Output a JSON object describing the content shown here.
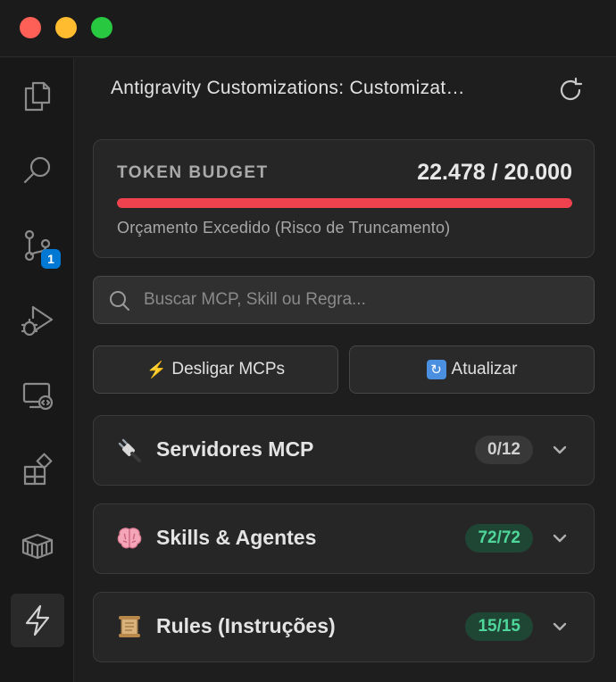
{
  "panel": {
    "title": "Antigravity Customizations: Customizat…",
    "refresh_icon": "refresh-icon"
  },
  "activity_bar": {
    "icons": [
      "files-icon",
      "search-icon",
      "source-control-icon",
      "run-debug-icon",
      "remote-explorer-icon",
      "extensions-icon",
      "package-icon",
      "lightning-icon"
    ],
    "source_control_badge": "1",
    "active": "lightning-icon"
  },
  "budget": {
    "label": "TOKEN BUDGET",
    "value": "22.478 / 20.000",
    "used": 22478,
    "limit": 20000,
    "fill_fraction": 1.0,
    "status": "Orçamento Excedido (Risco de Truncamento)",
    "bar_color": "#f0414f"
  },
  "search": {
    "placeholder": "Buscar MCP, Skill ou Regra..."
  },
  "actions": {
    "disable_mcps": "Desligar MCPs",
    "disable_mcps_emoji": "⚡",
    "refresh": "Atualizar",
    "refresh_emoji": "🔄"
  },
  "sections": [
    {
      "title": "Servidores MCP",
      "icon": "plug-icon",
      "count": "0/12",
      "style": "neutral"
    },
    {
      "title": "Skills & Agentes",
      "icon": "brain-icon",
      "count": "72/72",
      "style": "green"
    },
    {
      "title": "Rules (Instruções)",
      "icon": "scroll-icon",
      "count": "15/15",
      "style": "green"
    }
  ],
  "colors": {
    "accent_blue": "#0078d4",
    "success_green": "#4fd69a",
    "danger_red": "#f0414f"
  }
}
